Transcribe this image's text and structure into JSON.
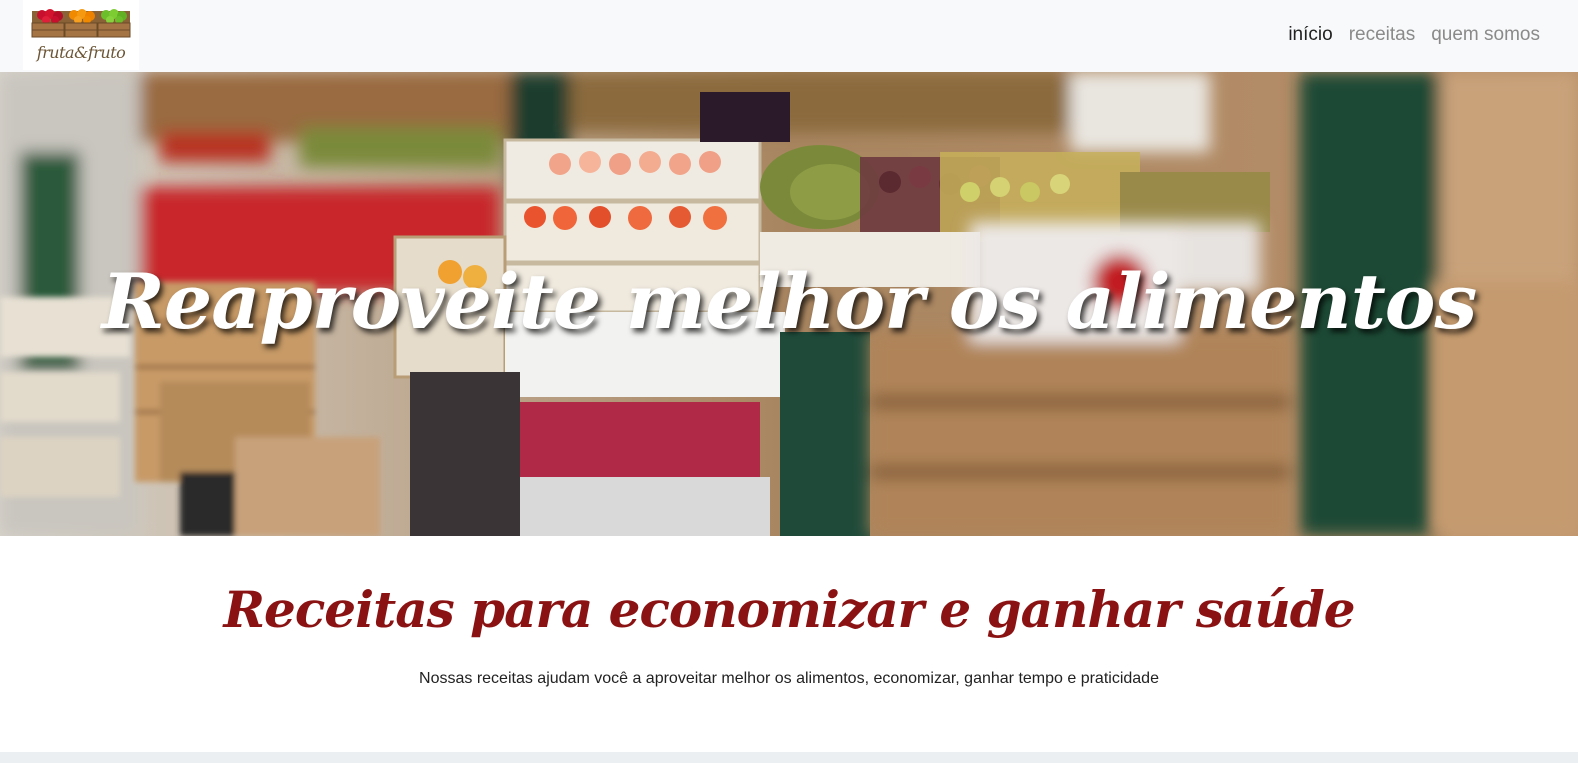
{
  "brand": {
    "logo_text": "fruta&fruto",
    "logo_icon": "fruit-crates-logo"
  },
  "nav": {
    "items": [
      {
        "label": "início",
        "active": true
      },
      {
        "label": "receitas",
        "active": false
      },
      {
        "label": "quem somos",
        "active": false
      }
    ]
  },
  "hero": {
    "title": "Reaproveite melhor os alimentos",
    "image": "market-fruit-crates-photo"
  },
  "intro": {
    "title": "Receitas para economizar e ganhar saúde",
    "subtitle": "Nossas receitas ajudam você a aproveitar melhor os alimentos, economizar, ganhar tempo e praticidade"
  },
  "colors": {
    "accent": "#8b1212",
    "navbar_bg": "#f8f9fa",
    "nav_active": "#222222",
    "nav_inactive": "#8a8a8a"
  }
}
